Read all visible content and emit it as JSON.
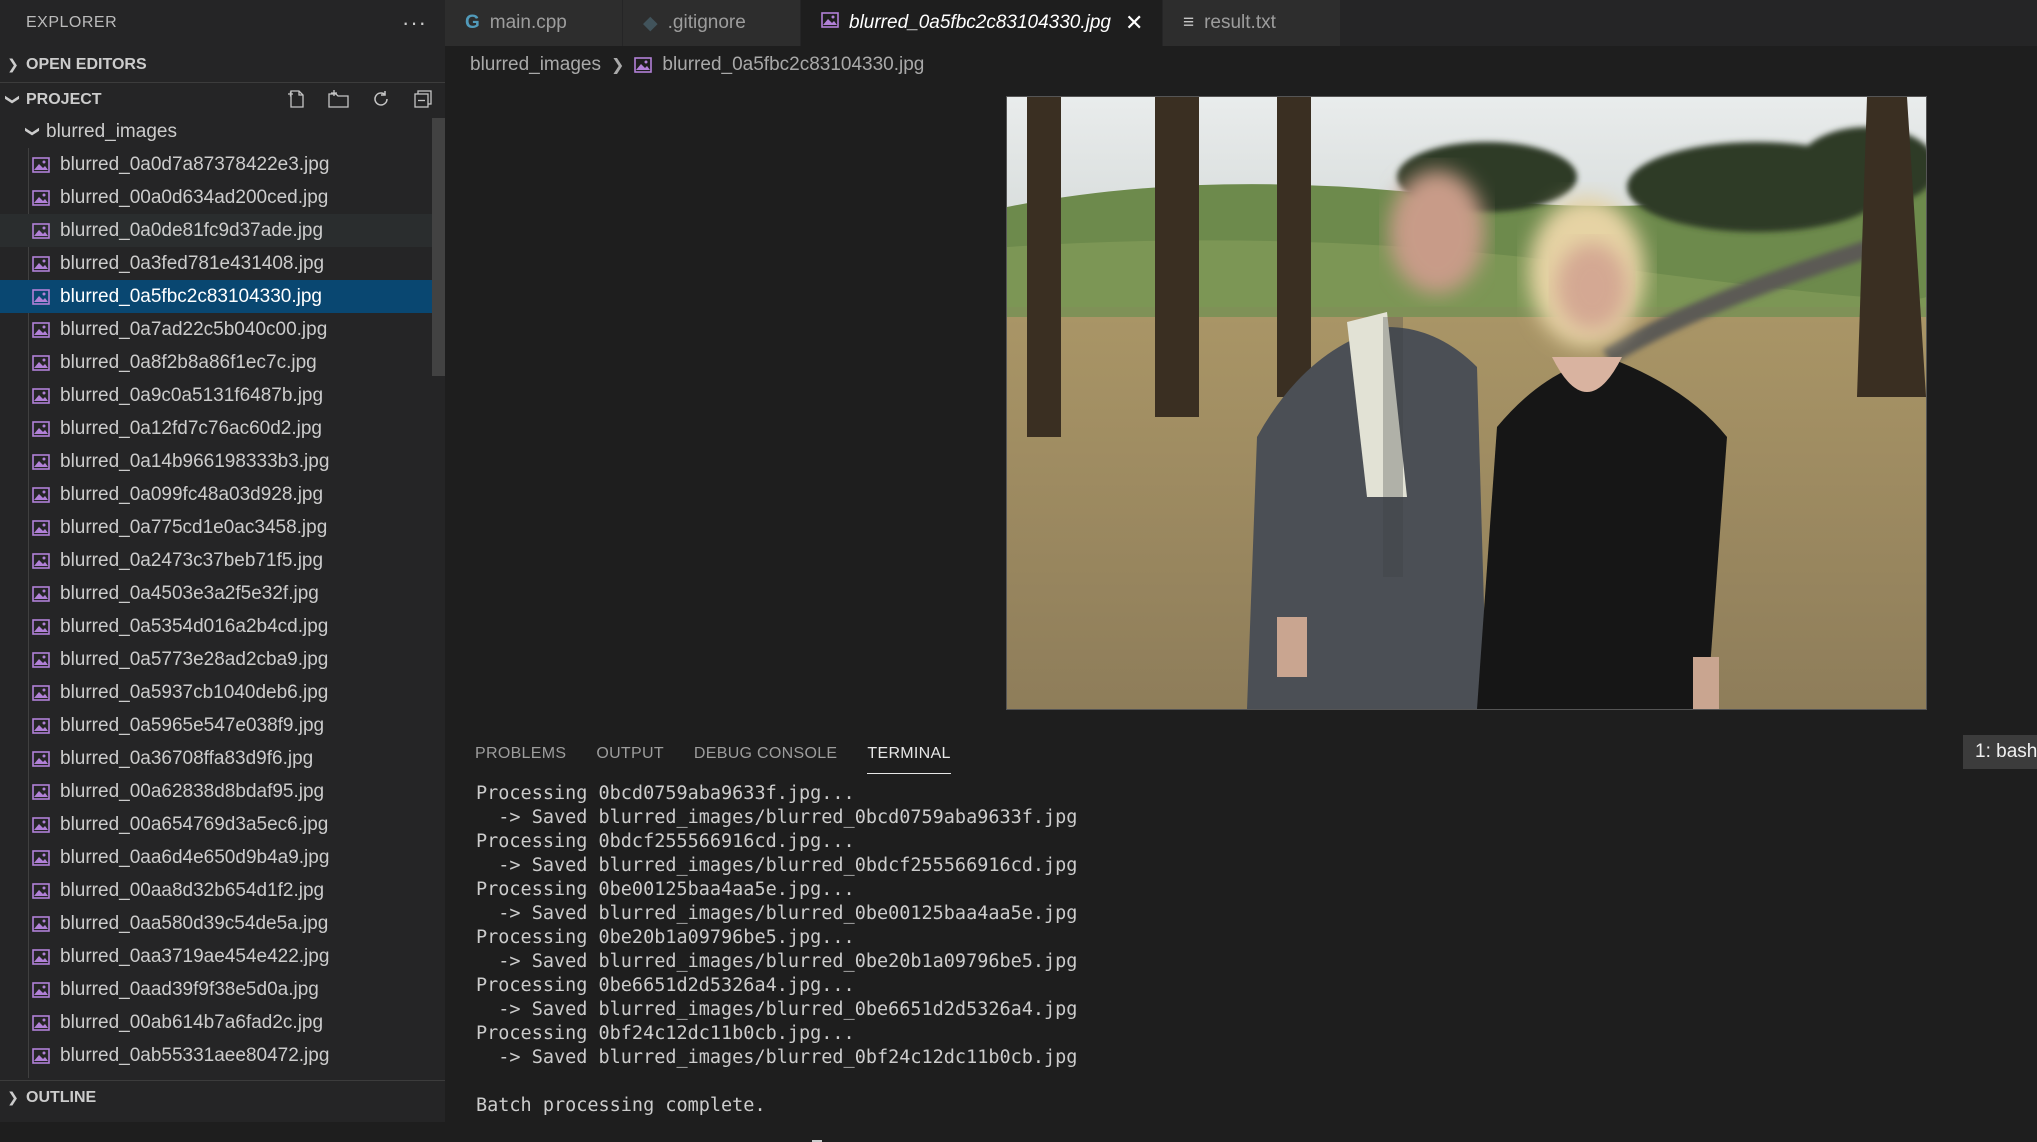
{
  "sidebar": {
    "title": "EXPLORER",
    "more_label": "···",
    "open_editors": "OPEN EDITORS",
    "project": "PROJECT",
    "folder": "blurred_images",
    "outline": "OUTLINE",
    "files": [
      "blurred_0a0d7a87378422e3.jpg",
      "blurred_00a0d634ad200ced.jpg",
      "blurred_0a0de81fc9d37ade.jpg",
      "blurred_0a3fed781e431408.jpg",
      "blurred_0a5fbc2c83104330.jpg",
      "blurred_0a7ad22c5b040c00.jpg",
      "blurred_0a8f2b8a86f1ec7c.jpg",
      "blurred_0a9c0a5131f6487b.jpg",
      "blurred_0a12fd7c76ac60d2.jpg",
      "blurred_0a14b966198333b3.jpg",
      "blurred_0a099fc48a03d928.jpg",
      "blurred_0a775cd1e0ac3458.jpg",
      "blurred_0a2473c37beb71f5.jpg",
      "blurred_0a4503e3a2f5e32f.jpg",
      "blurred_0a5354d016a2b4cd.jpg",
      "blurred_0a5773e28ad2cba9.jpg",
      "blurred_0a5937cb1040deb6.jpg",
      "blurred_0a5965e547e038f9.jpg",
      "blurred_0a36708ffa83d9f6.jpg",
      "blurred_00a62838d8bdaf95.jpg",
      "blurred_00a654769d3a5ec6.jpg",
      "blurred_0aa6d4e650d9b4a9.jpg",
      "blurred_00aa8d32b654d1f2.jpg",
      "blurred_0aa580d39c54de5a.jpg",
      "blurred_0aa3719ae454e422.jpg",
      "blurred_0aad39f9f38e5d0a.jpg",
      "blurred_00ab614b7a6fad2c.jpg",
      "blurred_0ab55331aee80472.jpg"
    ]
  },
  "tabs": [
    {
      "label": "main.cpp",
      "icon": "G"
    },
    {
      "label": ".gitignore",
      "icon": "◆"
    },
    {
      "label": "blurred_0a5fbc2c83104330.jpg",
      "icon": "img"
    },
    {
      "label": "result.txt",
      "icon": "≡"
    }
  ],
  "breadcrumb": {
    "folder": "blurred_images",
    "file": "blurred_0a5fbc2c83104330.jpg"
  },
  "panel": {
    "tabs": [
      "PROBLEMS",
      "OUTPUT",
      "DEBUG CONSOLE",
      "TERMINAL"
    ],
    "terminal_select": "1: bash",
    "lines": [
      "Processing 0bcd0759aba9633f.jpg...",
      "  -> Saved blurred_images/blurred_0bcd0759aba9633f.jpg",
      "Processing 0bdcf255566916cd.jpg...",
      "  -> Saved blurred_images/blurred_0bdcf255566916cd.jpg",
      "Processing 0be00125baa4aa5e.jpg...",
      "  -> Saved blurred_images/blurred_0be00125baa4aa5e.jpg",
      "Processing 0be20b1a09796be5.jpg...",
      "  -> Saved blurred_images/blurred_0be20b1a09796be5.jpg",
      "Processing 0be6651d2d5326a4.jpg...",
      "  -> Saved blurred_images/blurred_0be6651d2d5326a4.jpg",
      "Processing 0bf24c12dc11b0cb.jpg...",
      "  -> Saved blurred_images/blurred_0bf24c12dc11b0cb.jpg",
      "",
      "Batch processing complete."
    ]
  },
  "colors": {
    "accent_selected": "#094771",
    "image_icon": "#b180d7",
    "cpp_icon": "#519aba"
  }
}
